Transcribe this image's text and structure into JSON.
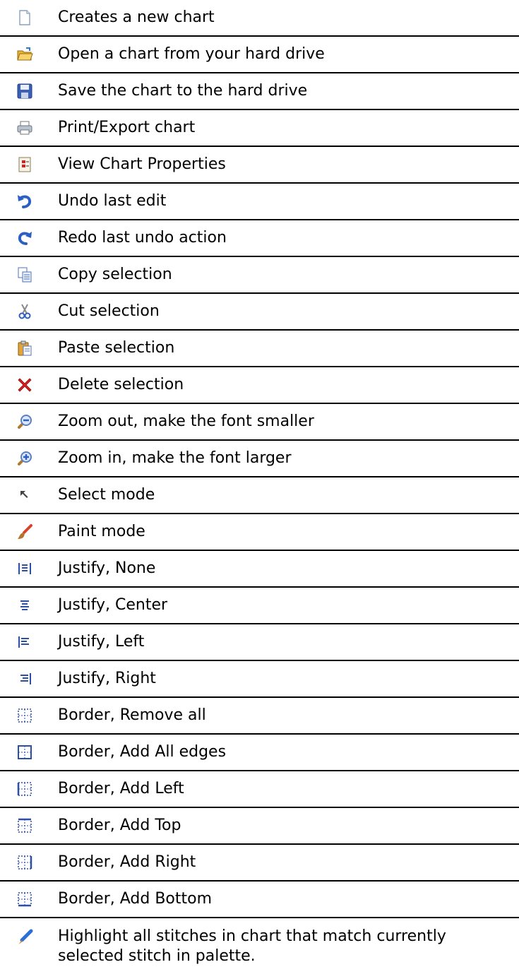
{
  "rows": [
    {
      "icon": "new-document-icon",
      "label": "Creates a new chart"
    },
    {
      "icon": "open-folder-icon",
      "label": "Open a chart from your hard drive"
    },
    {
      "icon": "save-disk-icon",
      "label": "Save the chart to the hard drive"
    },
    {
      "icon": "printer-icon",
      "label": "Print/Export chart"
    },
    {
      "icon": "properties-icon",
      "label": "View Chart Properties"
    },
    {
      "icon": "undo-icon",
      "label": "Undo last edit"
    },
    {
      "icon": "redo-icon",
      "label": "Redo last undo action"
    },
    {
      "icon": "copy-icon",
      "label": "Copy selection"
    },
    {
      "icon": "cut-icon",
      "label": "Cut selection"
    },
    {
      "icon": "paste-icon",
      "label": "Paste selection"
    },
    {
      "icon": "delete-icon",
      "label": "Delete selection"
    },
    {
      "icon": "zoom-out-icon",
      "label": "Zoom out, make the font smaller"
    },
    {
      "icon": "zoom-in-icon",
      "label": "Zoom in, make the font larger"
    },
    {
      "icon": "select-arrow-icon",
      "label": "Select mode"
    },
    {
      "icon": "paint-brush-icon",
      "label": "Paint mode"
    },
    {
      "icon": "justify-none-icon",
      "label": "Justify, None"
    },
    {
      "icon": "justify-center-icon",
      "label": "Justify, Center"
    },
    {
      "icon": "justify-left-icon",
      "label": "Justify, Left"
    },
    {
      "icon": "justify-right-icon",
      "label": "Justify, Right"
    },
    {
      "icon": "border-remove-all-icon",
      "label": "Border, Remove all"
    },
    {
      "icon": "border-all-edges-icon",
      "label": "Border, Add All edges"
    },
    {
      "icon": "border-left-icon",
      "label": "Border, Add Left"
    },
    {
      "icon": "border-top-icon",
      "label": "Border, Add Top"
    },
    {
      "icon": "border-right-icon",
      "label": "Border, Add Right"
    },
    {
      "icon": "border-bottom-icon",
      "label": "Border, Add Bottom"
    },
    {
      "icon": "highlight-pen-icon",
      "label": "Highlight all stitches in chart that match currently selected stitch in palette."
    }
  ],
  "colors": {
    "rule": "#000000",
    "blue": "#2c4fa8",
    "lightblue": "#7fa6e0",
    "red": "#d81e1e",
    "yellow": "#f2c23a",
    "gray": "#8a8a8a"
  }
}
